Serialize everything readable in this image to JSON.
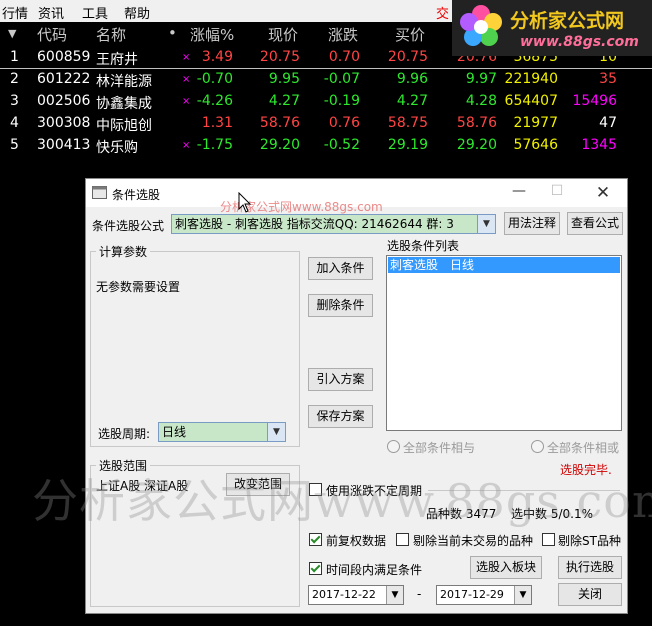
{
  "menu": {
    "items": [
      "行情",
      "资讯",
      "工具",
      "帮助"
    ],
    "extra": "交"
  },
  "brand": {
    "title": "分析家公式网",
    "url": "www.88gs.com"
  },
  "grid": {
    "sort_arrow": "▼",
    "headers": [
      "代码",
      "名称",
      "•",
      "涨幅%",
      "现价",
      "涨跌",
      "买价"
    ],
    "rows": [
      {
        "idx": "1",
        "code": "600859",
        "name": "王府井",
        "flag": "×",
        "pct": "3.49",
        "price": "20.75",
        "chg": "0.70",
        "bid": "20.75",
        "ask": "20.76",
        "vol": "36875",
        "cur": "10"
      },
      {
        "idx": "2",
        "code": "601222",
        "name": "林洋能源",
        "flag": "×",
        "pct": "-0.70",
        "price": "9.95",
        "chg": "-0.07",
        "bid": "9.96",
        "ask": "9.97",
        "vol": "221940",
        "cur": "35"
      },
      {
        "idx": "3",
        "code": "002506",
        "name": "协鑫集成",
        "flag": "×",
        "pct": "-4.26",
        "price": "4.27",
        "chg": "-0.19",
        "bid": "4.27",
        "ask": "4.28",
        "vol": "654407",
        "cur": "15496"
      },
      {
        "idx": "4",
        "code": "300308",
        "name": "中际旭创",
        "flag": "",
        "pct": "1.31",
        "price": "58.76",
        "chg": "0.76",
        "bid": "58.75",
        "ask": "58.76",
        "vol": "21977",
        "cur": "47"
      },
      {
        "idx": "5",
        "code": "300413",
        "name": "快乐购",
        "flag": "×",
        "pct": "-1.75",
        "price": "29.20",
        "chg": "-0.52",
        "bid": "29.19",
        "ask": "29.20",
        "vol": "57646",
        "cur": "1345"
      }
    ]
  },
  "dialog": {
    "title": "条件选股",
    "formula_label": "条件选股公式",
    "formula_value": "刺客选股    - 刺客选股  指标交流QQ: 21462644 群: 3",
    "usage_button": "用法注释",
    "view_formula_button": "查看公式",
    "calc_params_label": "计算参数",
    "no_params_text": "无参数需要设置",
    "period_label": "选股周期:",
    "period_value": "日线",
    "add_condition": "加入条件",
    "delete_condition": "删除条件",
    "import_scheme": "引入方案",
    "save_scheme": "保存方案",
    "list_label": "选股条件列表",
    "list_items": [
      {
        "formula": "刺客选股",
        "period": "日线"
      }
    ],
    "radio_and": "全部条件相与",
    "radio_or": "全部条件相或",
    "status": "选股完毕.",
    "range_label": "选股范围",
    "range_value": "上证A股 深证A股",
    "change_range": "改变范围",
    "use_uncertain_period": "使用涨跌不定周期",
    "variety_count": "品种数 3477",
    "selected_count": "选中数 5/0.1%",
    "pre_adjust": "前复权数据",
    "exclude_untraded": "剔除当前未交易的品种",
    "exclude_st": "剔除ST品种",
    "time_range": "时间段内满足条件",
    "to_block": "选股入板块",
    "execute": "执行选股",
    "date_from": "2017-12-22",
    "date_sep": "-",
    "date_to": "2017-12-29",
    "close": "关闭"
  },
  "watermark": {
    "big": "分析家公式网www.88gs.com",
    "small": "分析家公式网www.88gs.com"
  }
}
